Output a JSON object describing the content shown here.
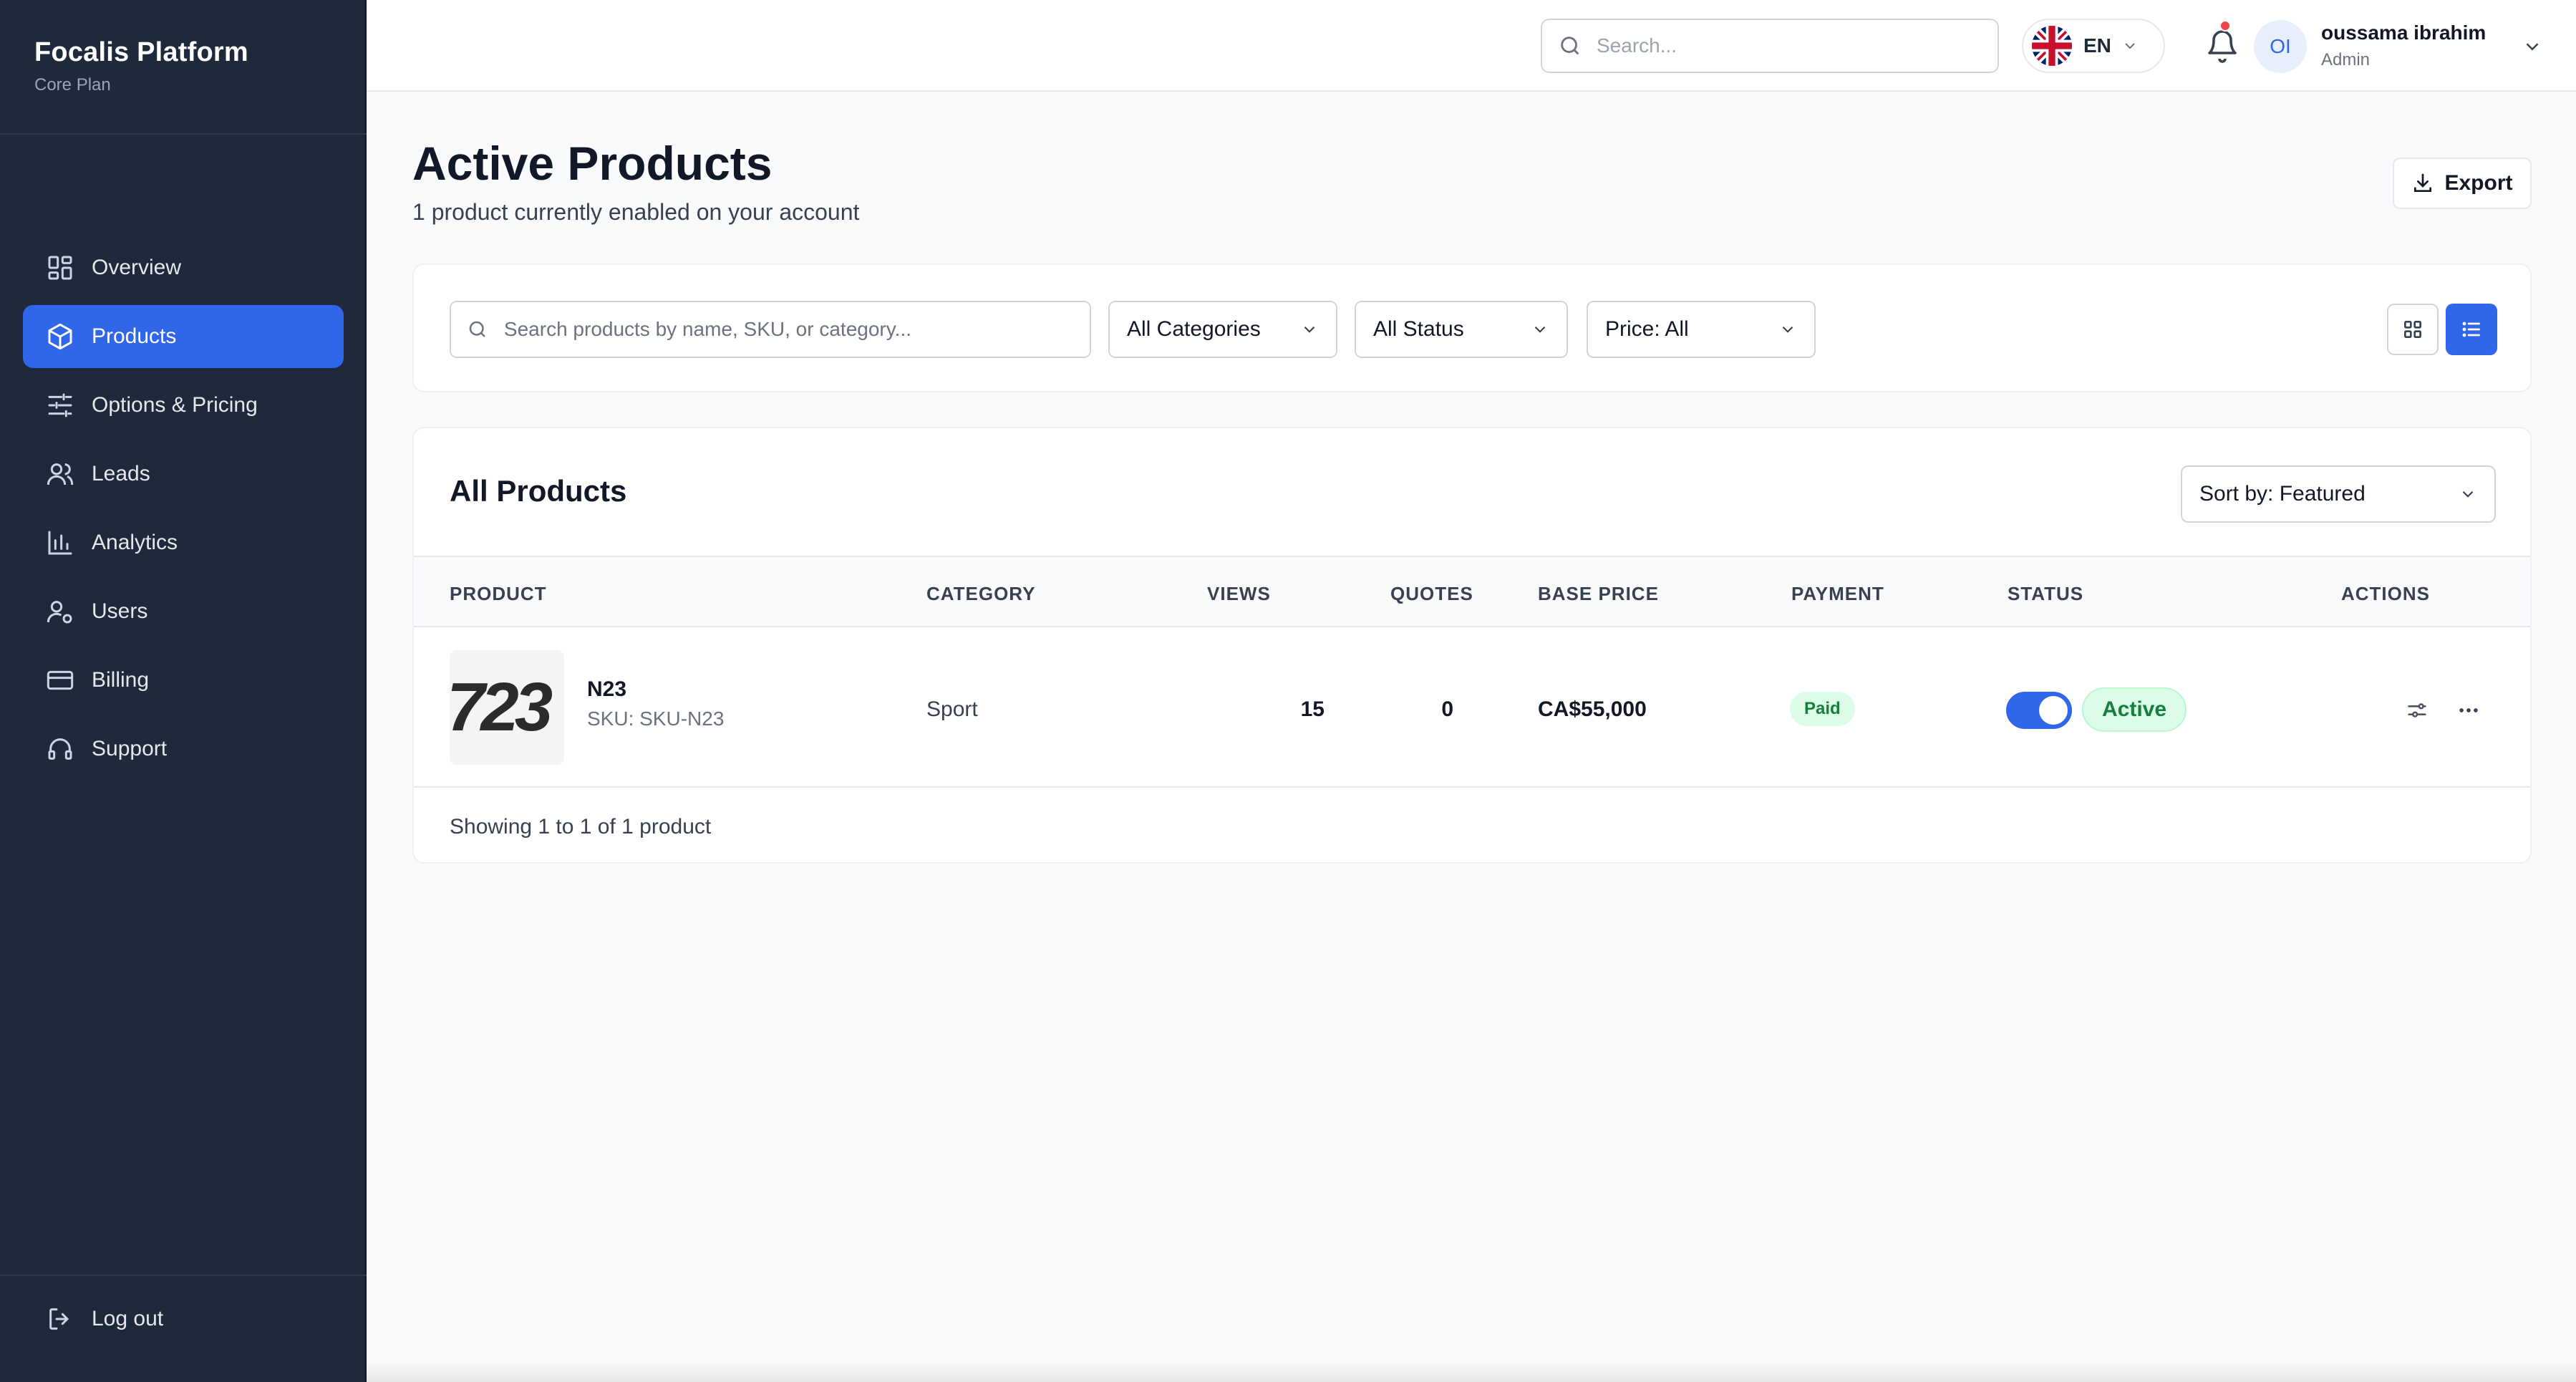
{
  "sidebar": {
    "brand_title": "Focalis Platform",
    "brand_sub": "Core Plan",
    "items": [
      {
        "label": "Overview",
        "icon": "dashboard-icon"
      },
      {
        "label": "Products",
        "icon": "box-icon",
        "active": true
      },
      {
        "label": "Options & Pricing",
        "icon": "sliders-icon"
      },
      {
        "label": "Leads",
        "icon": "users-icon"
      },
      {
        "label": "Analytics",
        "icon": "bar-chart-icon"
      },
      {
        "label": "Users",
        "icon": "user-gear-icon"
      },
      {
        "label": "Billing",
        "icon": "credit-card-icon"
      },
      {
        "label": "Support",
        "icon": "headset-icon"
      }
    ],
    "logout_label": "Log out"
  },
  "topbar": {
    "search_placeholder": "Search...",
    "language": "EN",
    "user_initials": "OI",
    "user_name": "oussama ibrahim",
    "user_role": "Admin",
    "has_notification": true
  },
  "page": {
    "title": "Active Products",
    "subtitle": "1 product currently enabled on your account",
    "export_label": "Export"
  },
  "filters": {
    "search_placeholder": "Search products by name, SKU, or category...",
    "category": "All Categories",
    "status": "All Status",
    "price": "Price: All",
    "view_mode": "list"
  },
  "products": {
    "title": "All Products",
    "sort": "Sort by: Featured",
    "columns": [
      "PRODUCT",
      "CATEGORY",
      "VIEWS",
      "QUOTES",
      "BASE PRICE",
      "PAYMENT",
      "STATUS",
      "ACTIONS"
    ],
    "rows": [
      {
        "name": "N23",
        "sku": "SKU: SKU-N23",
        "thumb_text": "723",
        "category": "Sport",
        "views": "15",
        "quotes": "0",
        "base_price": "CA$55,000",
        "payment": "Paid",
        "enabled": true,
        "status": "Active"
      }
    ],
    "footer": "Showing 1 to 1 of 1 product"
  },
  "colors": {
    "sidebar_bg": "#1e2a3b",
    "accent": "#2f66ea",
    "success_bg": "#dcfce7",
    "success_text": "#15803d"
  }
}
